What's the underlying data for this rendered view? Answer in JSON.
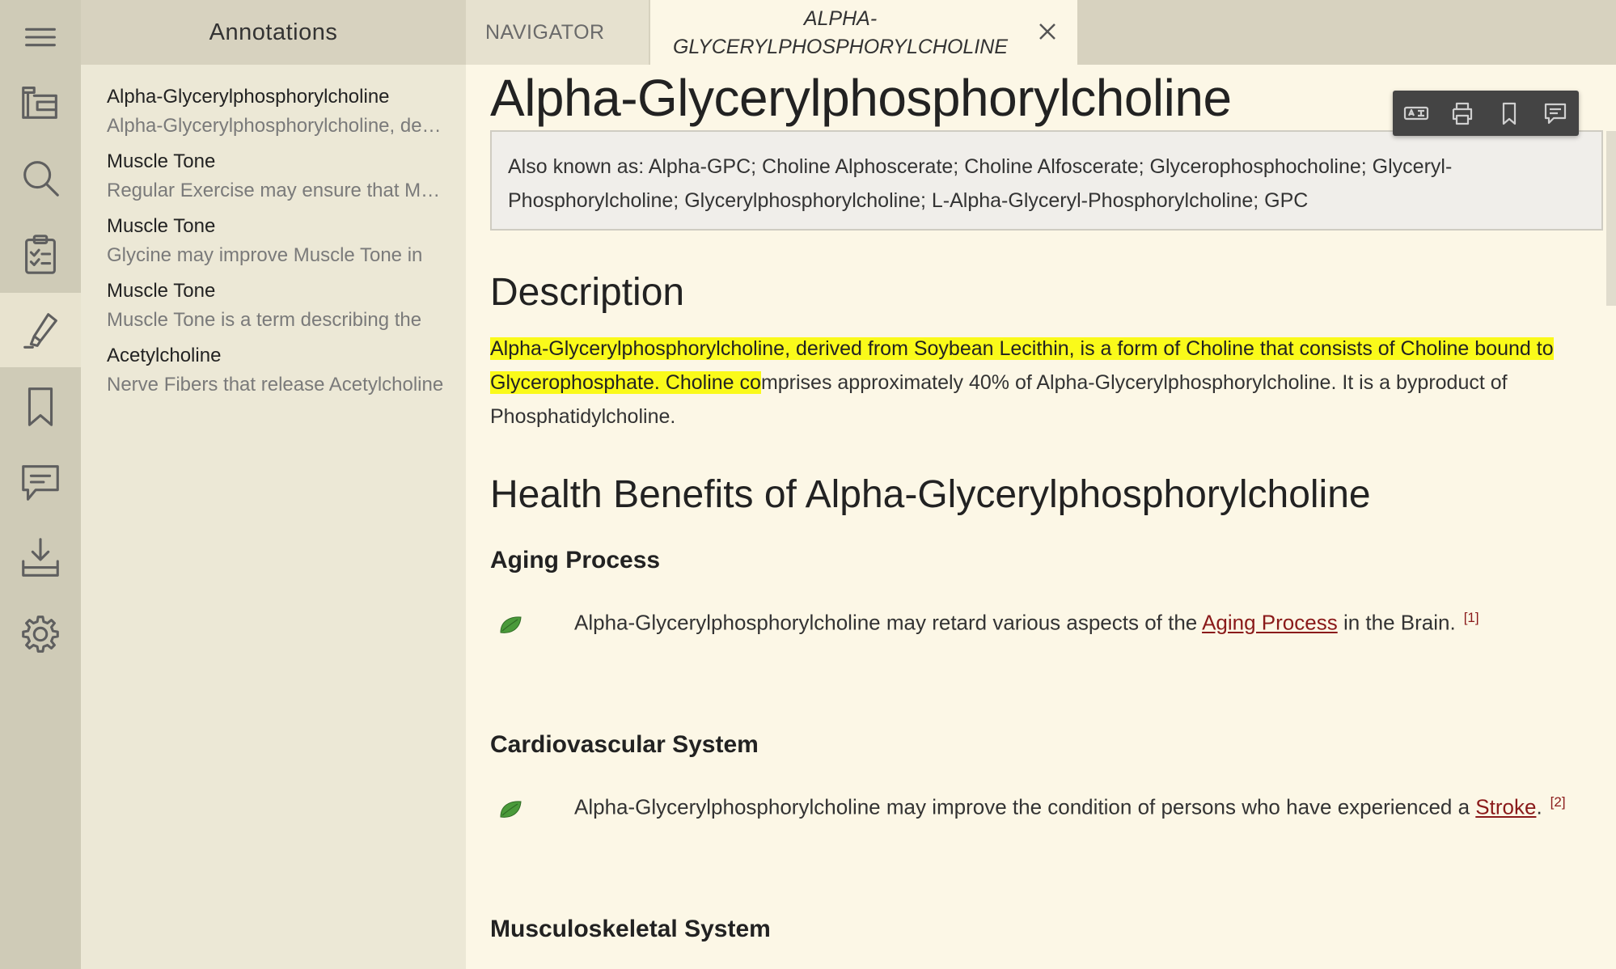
{
  "tabs": {
    "annotations": "Annotations",
    "navigator": "NAVIGATOR",
    "article": "ALPHA-GLYCERYLPHOSPHORYLCHOLINE"
  },
  "rail": {
    "icons": [
      "menu-icon",
      "library-icon",
      "search-icon",
      "checklist-icon",
      "highlighter-icon",
      "bookmark-icon",
      "comment-icon",
      "download-icon",
      "settings-icon"
    ],
    "active": "highlighter-icon"
  },
  "annotations": [
    {
      "title": "Alpha-Glycerylphosphorylcholine",
      "snippet": "Alpha-Glycerylphosphorylcholine, derived from Soybean Lecithin"
    },
    {
      "title": "Muscle Tone",
      "snippet": "Regular Exercise may ensure that Muscle Tone"
    },
    {
      "title": "Muscle Tone",
      "snippet": "Glycine may improve Muscle Tone in"
    },
    {
      "title": "Muscle Tone",
      "snippet": "Muscle Tone is a term describing the"
    },
    {
      "title": "Acetylcholine",
      "snippet": "Nerve Fibers that release Acetylcholine"
    }
  ],
  "article": {
    "title": "Alpha-Glycerylphosphorylcholine",
    "aka": "Also known as:  Alpha-GPC;  Choline Alphoscerate;  Choline Alfoscerate;  Glycerophosphocholine;  Glyceryl-Phosphorylcholine;  Glycerylphosphorylcholine;  L-Alpha-Glyceryl-Phosphorylcholine;  GPC",
    "description_heading": "Description",
    "description_highlight": "Alpha-Glycerylphosphorylcholine, derived from Soybean Lecithin, is a form of Choline that consists of Choline bound to Glycerophosphate.  Choline co",
    "description_rest": "mprises approximately 40% of Alpha-Glycerylphosphorylcholine.  It is a byproduct of Phosphatidylcholine.",
    "benefits_heading": "Health Benefits of Alpha-Glycerylphosphorylcholine",
    "sections": [
      {
        "heading": "Aging Process",
        "pre": "Alpha-Glycerylphosphorylcholine may retard various aspects of the ",
        "link": "Aging Process",
        "post": " in the Brain.",
        "ref": "[1]"
      },
      {
        "heading": "Cardiovascular System",
        "pre": "Alpha-Glycerylphosphorylcholine may improve the condition of persons who have experienced a ",
        "link": "Stroke",
        "post": ".",
        "ref": "[2]"
      },
      {
        "heading": "Musculoskeletal System"
      }
    ]
  },
  "toolbar": [
    "translate-icon",
    "print-icon",
    "bookmark-icon",
    "comment-icon"
  ],
  "colors": {
    "highlight": "#fafa1a",
    "link": "#8a1a1a",
    "toolbar": "#444444"
  }
}
